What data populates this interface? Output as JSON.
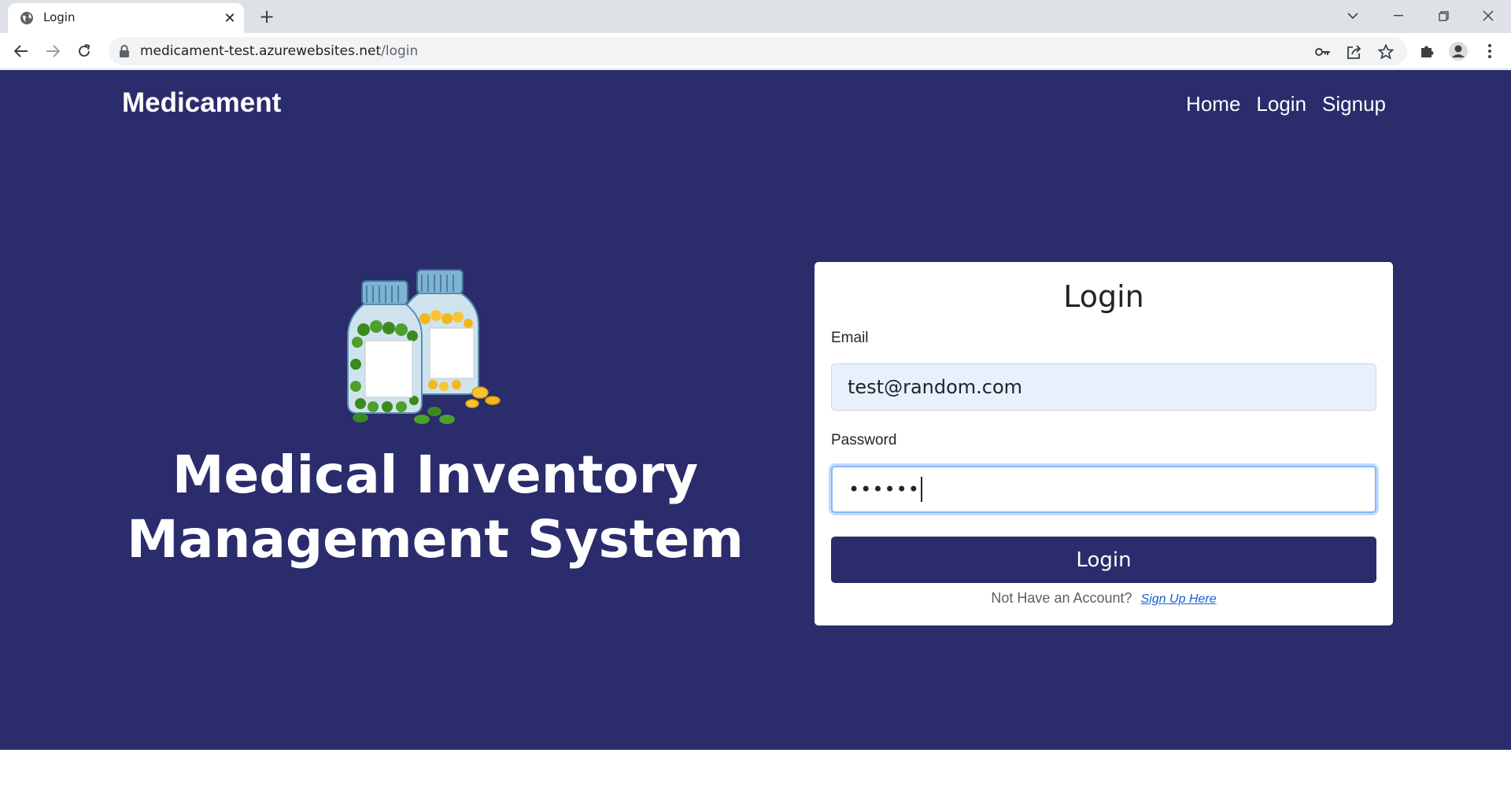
{
  "browser": {
    "tab_title": "Login",
    "url_host": "medicament-test.azurewebsites.net",
    "url_path": "/login"
  },
  "navbar": {
    "brand": "Medicament",
    "links": [
      "Home",
      "Login",
      "Signup"
    ]
  },
  "hero": {
    "title_line1": "Medical Inventory",
    "title_line2": "Management System"
  },
  "login_form": {
    "title": "Login",
    "email_label": "Email",
    "email_value": "test@random.com",
    "password_label": "Password",
    "password_value": "••••••",
    "submit_label": "Login",
    "signup_prompt": "Not Have an Account?",
    "signup_link": "Sign Up Here"
  },
  "colors": {
    "brand_bg": "#2a2c6c",
    "autofill_bg": "#e8f0fe",
    "focus_ring": "#86b7fe",
    "link": "#1a5fd6"
  }
}
